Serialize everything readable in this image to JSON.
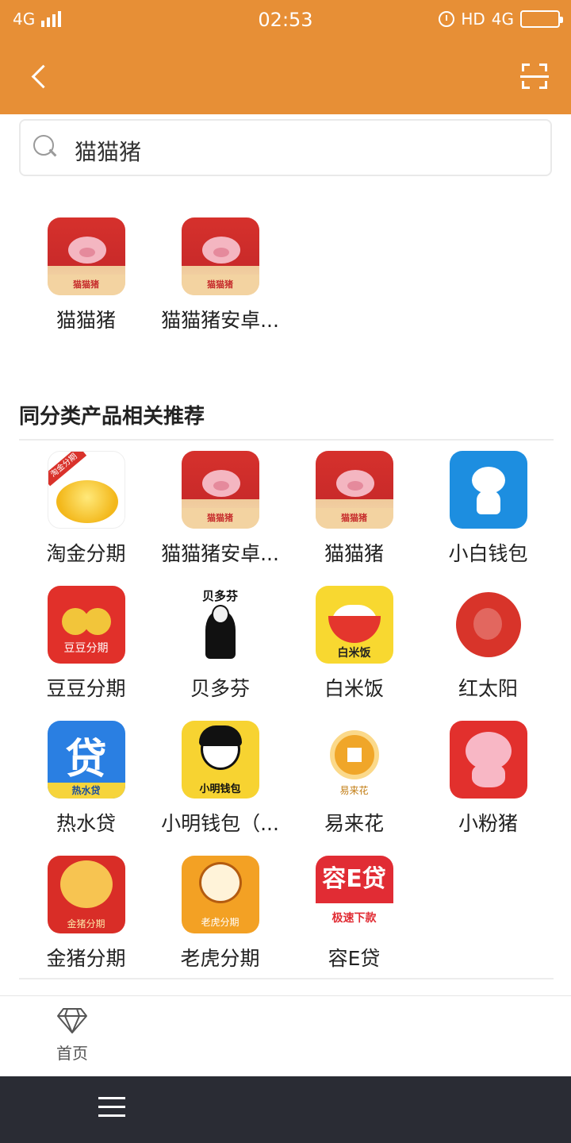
{
  "status_bar": {
    "network_left": "4G",
    "time": "02:53",
    "right_text": "HD",
    "network_right": "4G"
  },
  "nav": {
    "back_icon": "chevron-left-icon",
    "scan_icon": "scan-icon"
  },
  "search": {
    "value": "猫猫猪",
    "icon": "search-icon"
  },
  "results": [
    {
      "name": "猫猫猪",
      "icon": "maomaozhu"
    },
    {
      "name": "猫猫猪安卓...",
      "icon": "maomaozhu"
    }
  ],
  "section": {
    "title": "同分类产品相关推荐"
  },
  "recommendations": [
    {
      "name": "淘金分期",
      "icon": "taojin"
    },
    {
      "name": "猫猫猪安卓...",
      "icon": "maomaozhu"
    },
    {
      "name": "猫猫猪",
      "icon": "maomaozhu"
    },
    {
      "name": "小白钱包",
      "icon": "xiaobai"
    },
    {
      "name": "豆豆分期",
      "icon": "doudou"
    },
    {
      "name": "贝多芬",
      "icon": "beiduofen"
    },
    {
      "name": "白米饭",
      "icon": "baimifan"
    },
    {
      "name": "红太阳",
      "icon": "hongtaiyang"
    },
    {
      "name": "热水贷",
      "icon": "reshui"
    },
    {
      "name": "小明钱包（...",
      "icon": "xiaoming"
    },
    {
      "name": "易来花",
      "icon": "yilaihua"
    },
    {
      "name": "小粉猪",
      "icon": "xiaofen"
    },
    {
      "name": "金猪分期",
      "icon": "jinzhu"
    },
    {
      "name": "老虎分期",
      "icon": "laohu"
    },
    {
      "name": "容E贷",
      "icon": "rongedai"
    }
  ],
  "icon_text": {
    "maomaozhu": "猫猫猪",
    "taojin": "淘金分期",
    "doudou": "豆豆分期",
    "beiduofen": "贝多芬",
    "baimifan": "白米饭",
    "reshui_char": "贷",
    "reshui": "热水贷",
    "xiaoming": "小明钱包",
    "yilaihua": "易来花",
    "jinzhu": "金猪分期",
    "laohu": "老虎分期",
    "rongedai_top": "容E贷",
    "rongedai": "极速下款"
  },
  "bottom_nav": {
    "home_label": "首页",
    "home_icon": "diamond-icon"
  },
  "colors": {
    "header": "#e78f36",
    "system_nav": "#2a2c34"
  }
}
